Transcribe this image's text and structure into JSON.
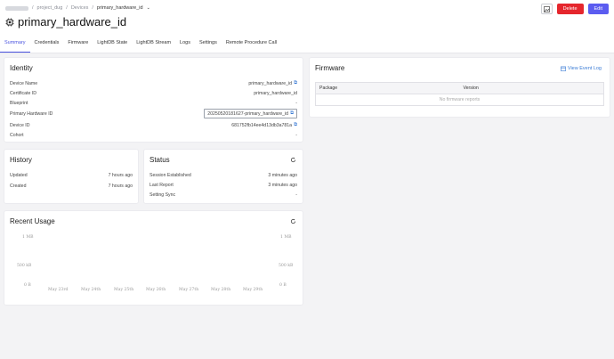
{
  "breadcrumb": {
    "project": "project_dug",
    "devices": "Devices",
    "current": "primary_hardware_id"
  },
  "page_title": "primary_hardware_id",
  "actions": {
    "delete": "Delete",
    "edit": "Edit"
  },
  "tabs": [
    "Summary",
    "Credentials",
    "Firmware",
    "LightDB State",
    "LightDB Stream",
    "Logs",
    "Settings",
    "Remote Procedure Call"
  ],
  "identity": {
    "title": "Identity",
    "rows": [
      {
        "label": "Device Name",
        "value": "primary_hardware_id"
      },
      {
        "label": "Certificate ID",
        "value": "primary_hardware_id"
      },
      {
        "label": "Blueprint",
        "value": "-"
      },
      {
        "label": "Primary Hardware ID",
        "value": "20250520181627-primary_hardware_id"
      },
      {
        "label": "Device ID",
        "value": "681752fb14ee4d13db3a781a"
      },
      {
        "label": "Cohort",
        "value": "-"
      }
    ]
  },
  "history": {
    "title": "History",
    "rows": [
      {
        "label": "Updated",
        "value": "7 hours ago"
      },
      {
        "label": "Created",
        "value": "7 hours ago"
      }
    ]
  },
  "status": {
    "title": "Status",
    "rows": [
      {
        "label": "Session Established",
        "value": "3 minutes ago"
      },
      {
        "label": "Last Report",
        "value": "3 minutes ago"
      },
      {
        "label": "Setting Sync",
        "value": "-"
      }
    ]
  },
  "firmware": {
    "title": "Firmware",
    "link": "View Event Log",
    "columns": [
      "Package",
      "Version"
    ],
    "empty": "No firmware reports"
  },
  "usage": {
    "title": "Recent Usage",
    "y_left": [
      "1 MB",
      "500 kB",
      "0 B"
    ],
    "y_right": [
      "1 MB",
      "500 kB",
      "0 B"
    ],
    "x_ticks": [
      "May 23rd",
      "May 24th",
      "May 25th",
      "May 26th",
      "May 27th",
      "May 28th",
      "May 29th"
    ]
  },
  "colors": {
    "accent": "#4a53e0",
    "delete": "#e5262d",
    "edit": "#5b5cf0",
    "link": "#3a7bd5"
  }
}
